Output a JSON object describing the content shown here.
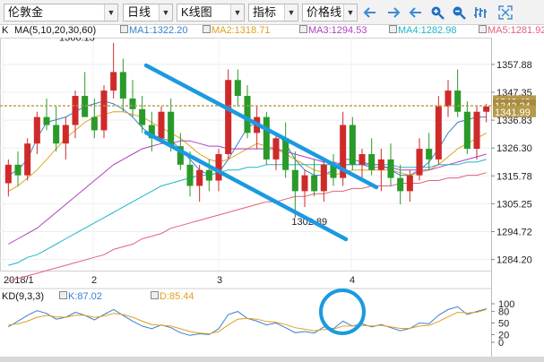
{
  "toolbar": {
    "symbol": "伦敦金",
    "period": "日线",
    "chart_type": "K线图",
    "indicator": "指标",
    "price_line": "价格线",
    "icons": [
      "back-icon",
      "forward-icon",
      "zoom-in-icon",
      "zoom-out-icon",
      "bar-chart-icon",
      "fullscreen-icon"
    ]
  },
  "legend": {
    "k_label": "K",
    "ma_label": "MA(5,10,20,30,60)",
    "ma1": "MA1:1322.20",
    "ma2": "MA2:1318.71",
    "ma3": "MA3:1294.53",
    "ma4": "MA4:1282.98",
    "ma5": "MA5:1281.92"
  },
  "price_axis": {
    "ticks": [
      "1357.88",
      "1347.35",
      "1336.83",
      "1326.30",
      "1315.78",
      "1305.25",
      "1294.72",
      "1284.20"
    ],
    "tags": [
      "1342.49",
      "1342.24",
      "1341.99"
    ]
  },
  "annotations": {
    "high_label": "1366.13",
    "low_label": "1302.89"
  },
  "date_axis": {
    "labels": [
      "2018/1",
      "2",
      "3",
      "4"
    ]
  },
  "kd": {
    "label": "KD(9,3,3)",
    "k_value": "K:87.02",
    "d_value": "D:85.44",
    "ticks": [
      "100",
      "80",
      "50",
      "20",
      "0"
    ]
  },
  "colors": {
    "up": "#cf2a2a",
    "down": "#2a9a2a",
    "ma1": "#3a7fd0",
    "ma2": "#e0a020",
    "ma3": "#b040c0",
    "ma4": "#1fb6c8",
    "ma5": "#e06080",
    "channel": "#1a9ae0",
    "dotted": "#b59a45",
    "tag": "#b59a4a"
  },
  "chart_data": {
    "type": "candlestick",
    "title": "伦敦金 日线",
    "ylim": [
      1280,
      1368
    ],
    "x": [
      "2018/1",
      "2",
      "3",
      "4"
    ],
    "candles": [
      [
        1313,
        1322,
        1308,
        1320
      ],
      [
        1320,
        1325,
        1312,
        1316
      ],
      [
        1316,
        1330,
        1314,
        1328
      ],
      [
        1328,
        1340,
        1324,
        1338
      ],
      [
        1338,
        1345,
        1333,
        1335
      ],
      [
        1335,
        1342,
        1325,
        1328
      ],
      [
        1328,
        1338,
        1322,
        1335
      ],
      [
        1335,
        1348,
        1330,
        1346
      ],
      [
        1346,
        1355,
        1340,
        1338
      ],
      [
        1338,
        1345,
        1330,
        1333
      ],
      [
        1333,
        1350,
        1330,
        1348
      ],
      [
        1348,
        1366,
        1345,
        1355
      ],
      [
        1355,
        1360,
        1340,
        1345
      ],
      [
        1345,
        1352,
        1338,
        1341
      ],
      [
        1341,
        1346,
        1332,
        1335
      ],
      [
        1335,
        1340,
        1325,
        1330
      ],
      [
        1330,
        1342,
        1328,
        1340
      ],
      [
        1340,
        1345,
        1325,
        1327
      ],
      [
        1327,
        1332,
        1318,
        1320
      ],
      [
        1320,
        1325,
        1308,
        1312
      ],
      [
        1312,
        1320,
        1306,
        1318
      ],
      [
        1318,
        1322,
        1310,
        1314
      ],
      [
        1314,
        1326,
        1310,
        1324
      ],
      [
        1324,
        1356,
        1322,
        1352
      ],
      [
        1352,
        1356,
        1342,
        1346
      ],
      [
        1346,
        1350,
        1330,
        1332
      ],
      [
        1332,
        1342,
        1326,
        1338
      ],
      [
        1338,
        1340,
        1320,
        1322
      ],
      [
        1322,
        1332,
        1318,
        1330
      ],
      [
        1330,
        1336,
        1315,
        1318
      ],
      [
        1318,
        1325,
        1303,
        1310
      ],
      [
        1310,
        1318,
        1304,
        1316
      ],
      [
        1316,
        1322,
        1308,
        1310
      ],
      [
        1310,
        1322,
        1306,
        1320
      ],
      [
        1320,
        1324,
        1312,
        1315
      ],
      [
        1315,
        1340,
        1312,
        1335
      ],
      [
        1335,
        1338,
        1318,
        1320
      ],
      [
        1320,
        1326,
        1314,
        1324
      ],
      [
        1324,
        1330,
        1316,
        1318
      ],
      [
        1318,
        1326,
        1310,
        1322
      ],
      [
        1322,
        1328,
        1312,
        1315
      ],
      [
        1315,
        1320,
        1305,
        1310
      ],
      [
        1310,
        1318,
        1306,
        1316
      ],
      [
        1316,
        1330,
        1314,
        1326
      ],
      [
        1326,
        1332,
        1318,
        1322
      ],
      [
        1322,
        1346,
        1320,
        1342
      ],
      [
        1342,
        1352,
        1338,
        1348
      ],
      [
        1348,
        1356,
        1338,
        1340
      ],
      [
        1340,
        1344,
        1324,
        1326
      ],
      [
        1326,
        1342,
        1322,
        1340
      ],
      [
        1340,
        1343,
        1336,
        1342
      ]
    ],
    "series": [
      {
        "name": "MA1",
        "values": [
          1316,
          1318,
          1322,
          1330,
          1336,
          1337,
          1338,
          1340,
          1342,
          1343,
          1344,
          1343,
          1341,
          1338,
          1334,
          1331,
          1330,
          1329,
          1326,
          1322,
          1318,
          1316,
          1317,
          1322,
          1328,
          1334,
          1336,
          1334,
          1332,
          1328,
          1322,
          1318,
          1316,
          1316,
          1318,
          1322,
          1322,
          1321,
          1320,
          1320,
          1318,
          1316,
          1316,
          1318,
          1321,
          1326,
          1332,
          1336,
          1337,
          1338,
          1338
        ]
      },
      {
        "name": "MA2",
        "values": [
          1310,
          1312,
          1315,
          1318,
          1322,
          1326,
          1330,
          1333,
          1336,
          1338,
          1339,
          1340,
          1340,
          1339,
          1338,
          1336,
          1334,
          1332,
          1330,
          1327,
          1324,
          1322,
          1321,
          1322,
          1324,
          1326,
          1328,
          1327,
          1326,
          1324,
          1322,
          1320,
          1318,
          1317,
          1316,
          1317,
          1318,
          1318,
          1318,
          1318,
          1318,
          1317,
          1316,
          1317,
          1318,
          1320,
          1323,
          1326,
          1328,
          1330,
          1332
        ]
      },
      {
        "name": "MA3",
        "values": [
          1290,
          1292,
          1294,
          1296,
          1299,
          1302,
          1305,
          1308,
          1311,
          1314,
          1317,
          1320,
          1322,
          1324,
          1326,
          1327,
          1328,
          1328,
          1329,
          1329,
          1328,
          1327,
          1327,
          1326,
          1326,
          1326,
          1326,
          1326,
          1326,
          1325,
          1324,
          1323,
          1322,
          1321,
          1321,
          1320,
          1320,
          1320,
          1319,
          1319,
          1319,
          1318,
          1318,
          1318,
          1318,
          1319,
          1320,
          1321,
          1322,
          1323,
          1324
        ]
      },
      {
        "name": "MA4",
        "values": [
          1282,
          1283,
          1285,
          1286,
          1288,
          1290,
          1292,
          1294,
          1296,
          1298,
          1300,
          1302,
          1304,
          1306,
          1308,
          1310,
          1312,
          1313,
          1314,
          1315,
          1316,
          1316,
          1317,
          1318,
          1318,
          1319,
          1319,
          1320,
          1320,
          1320,
          1320,
          1320,
          1320,
          1320,
          1320,
          1320,
          1320,
          1320,
          1320,
          1320,
          1320,
          1319,
          1319,
          1319,
          1319,
          1320,
          1320,
          1320,
          1321,
          1321,
          1322
        ]
      },
      {
        "name": "MA5",
        "values": [
          1276,
          1277,
          1278,
          1279,
          1280,
          1281,
          1282,
          1283,
          1284,
          1285,
          1286,
          1288,
          1289,
          1290,
          1292,
          1293,
          1294,
          1296,
          1297,
          1298,
          1299,
          1300,
          1301,
          1302,
          1303,
          1304,
          1305,
          1306,
          1306,
          1307,
          1308,
          1308,
          1309,
          1309,
          1310,
          1310,
          1311,
          1311,
          1312,
          1312,
          1312,
          1313,
          1313,
          1313,
          1314,
          1314,
          1315,
          1315,
          1316,
          1316,
          1317
        ]
      }
    ],
    "kd_k": [
      40,
      55,
      70,
      82,
      75,
      60,
      65,
      78,
      70,
      58,
      72,
      85,
      70,
      55,
      42,
      35,
      45,
      38,
      25,
      18,
      22,
      20,
      35,
      72,
      80,
      62,
      55,
      45,
      50,
      38,
      25,
      28,
      24,
      40,
      35,
      55,
      42,
      48,
      40,
      46,
      38,
      30,
      36,
      50,
      48,
      70,
      85,
      92,
      72,
      80,
      87
    ],
    "kd_d": [
      45,
      48,
      55,
      65,
      70,
      66,
      65,
      70,
      70,
      65,
      68,
      75,
      72,
      65,
      55,
      46,
      44,
      42,
      35,
      28,
      24,
      22,
      28,
      45,
      60,
      62,
      60,
      54,
      52,
      46,
      38,
      34,
      30,
      33,
      34,
      42,
      42,
      44,
      42,
      44,
      40,
      36,
      36,
      42,
      44,
      54,
      66,
      78,
      76,
      78,
      85
    ]
  }
}
